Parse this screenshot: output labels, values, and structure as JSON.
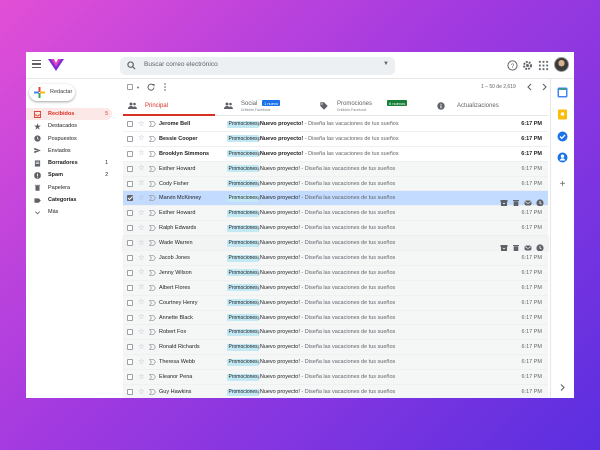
{
  "search": {
    "placeholder": "Buscar correo electrónico"
  },
  "compose": {
    "label": "Redactar"
  },
  "sidebar": {
    "items": [
      {
        "label": "Recibidos",
        "count": "5",
        "icon": "inbox-icon",
        "active": true
      },
      {
        "label": "Destacados",
        "count": "",
        "icon": "star-icon"
      },
      {
        "label": "Pospuestos",
        "count": "",
        "icon": "clock-icon"
      },
      {
        "label": "Enviados",
        "count": "",
        "icon": "send-icon"
      },
      {
        "label": "Borradores",
        "count": "1",
        "icon": "draft-icon",
        "bold": true
      },
      {
        "label": "Spam",
        "count": "2",
        "icon": "spam-icon",
        "bold": true
      },
      {
        "label": "Papelera",
        "count": "",
        "icon": "trash-icon"
      },
      {
        "label": "Categorías",
        "count": "",
        "icon": "label-icon",
        "bold": true
      },
      {
        "label": "Más",
        "count": "",
        "icon": "chevron-down-icon"
      }
    ]
  },
  "toolbar": {
    "pager": "1 – 50 de 2,619"
  },
  "tabs": [
    {
      "label": "Principal",
      "sub": "",
      "badge": ""
    },
    {
      "label": "Social",
      "sub": "Dribbble,Facebook",
      "badge": "1 nuevo",
      "badge_color": "#1a73e8"
    },
    {
      "label": "Promociones",
      "sub": "Dribbble,Facebook",
      "badge": "6 nuevos",
      "badge_color": "#188038"
    },
    {
      "label": "Actualizaciones",
      "sub": "",
      "badge": ""
    }
  ],
  "emails": [
    {
      "sender": "Jerome Bell",
      "label": "Promociones",
      "subject": "¡Nuevo proyecto!",
      "snippet": " - Diseña las vacaciones de tus sueños",
      "date": "6:17 PM",
      "unread": true
    },
    {
      "sender": "Bessie Cooper",
      "label": "Promociones",
      "subject": "¡Nuevo proyecto!",
      "snippet": " - Diseña las vacaciones de tus sueños",
      "date": "6:17 PM",
      "unread": true
    },
    {
      "sender": "Brooklyn Simmons",
      "label": "Promociones",
      "subject": "¡Nuevo proyecto!",
      "snippet": " - Diseña las vacaciones de tus sueños",
      "date": "6:17 PM",
      "unread": true
    },
    {
      "sender": "Esther Howard",
      "label": "Promociones",
      "subject": "¡Nuevo proyecto!",
      "snippet": " - Diseña las vacaciones de tus sueños",
      "date": "6:17 PM"
    },
    {
      "sender": "Cody Fisher",
      "label": "Promociones",
      "subject": "¡Nuevo proyecto!",
      "snippet": " - Diseña las vacaciones de tus sueños",
      "date": "6:17 PM"
    },
    {
      "sender": "Marvin McKinney",
      "label": "Promociones",
      "subject": "¡Nuevo proyecto!",
      "snippet": " - Diseña las vacaciones de tus sueños",
      "date": "",
      "selected": true
    },
    {
      "sender": "Esther Howard",
      "label": "Promociones",
      "subject": "¡Nuevo proyecto!",
      "snippet": " - Diseña las vacaciones de tus sueños",
      "date": "6:17 PM"
    },
    {
      "sender": "Ralph Edwards",
      "label": "Promociones",
      "subject": "¡Nuevo proyecto!",
      "snippet": " - Diseña las vacaciones de tus sueños",
      "date": "6:17 PM"
    },
    {
      "sender": "Wade Warren",
      "label": "Promociones",
      "subject": "¡Nuevo proyecto!",
      "snippet": " - Diseña las vacaciones de tus sueños",
      "date": "",
      "hover": true
    },
    {
      "sender": "Jacob Jones",
      "label": "Promociones",
      "subject": "¡Nuevo proyecto!",
      "snippet": " - Diseña las vacaciones de tus sueños",
      "date": "6:17 PM"
    },
    {
      "sender": "Jenny Wilson",
      "label": "Promociones",
      "subject": "¡Nuevo proyecto!",
      "snippet": " - Diseña las vacaciones de tus sueños",
      "date": "6:17 PM"
    },
    {
      "sender": "Albert Flores",
      "label": "Promociones",
      "subject": "¡Nuevo proyecto!",
      "snippet": " - Diseña las vacaciones de tus sueños",
      "date": "6:17 PM"
    },
    {
      "sender": "Courtney Henry",
      "label": "Promociones",
      "subject": "¡Nuevo proyecto!",
      "snippet": " - Diseña las vacaciones de tus sueños",
      "date": "6:17 PM"
    },
    {
      "sender": "Annette Black",
      "label": "Promociones",
      "subject": "¡Nuevo proyecto!",
      "snippet": " - Diseña las vacaciones de tus sueños",
      "date": "6:17 PM"
    },
    {
      "sender": "Robert Fox",
      "label": "Promociones",
      "subject": "¡Nuevo proyecto!",
      "snippet": " - Diseña las vacaciones de tus sueños",
      "date": "6:17 PM"
    },
    {
      "sender": "Ronald Richards",
      "label": "Promociones",
      "subject": "¡Nuevo proyecto!",
      "snippet": " - Diseña las vacaciones de tus sueños",
      "date": "6:17 PM"
    },
    {
      "sender": "Theresa Webb",
      "label": "Promociones",
      "subject": "¡Nuevo proyecto!",
      "snippet": " - Diseña las vacaciones de tus sueños",
      "date": "6:17 PM"
    },
    {
      "sender": "Eleanor Pena",
      "label": "Promociones",
      "subject": "¡Nuevo proyecto!",
      "snippet": " - Diseña las vacaciones de tus sueños",
      "date": "6:17 PM"
    },
    {
      "sender": "Guy Hawkins",
      "label": "Promociones",
      "subject": "¡Nuevo proyecto!",
      "snippet": " - Diseña las vacaciones de tus sueños",
      "date": "6:17 PM"
    }
  ],
  "colors": {
    "accent": "#d93025",
    "selected_row": "#c2dbff",
    "label_bg": "#c3e9f5",
    "brand": "#8a2be2"
  }
}
